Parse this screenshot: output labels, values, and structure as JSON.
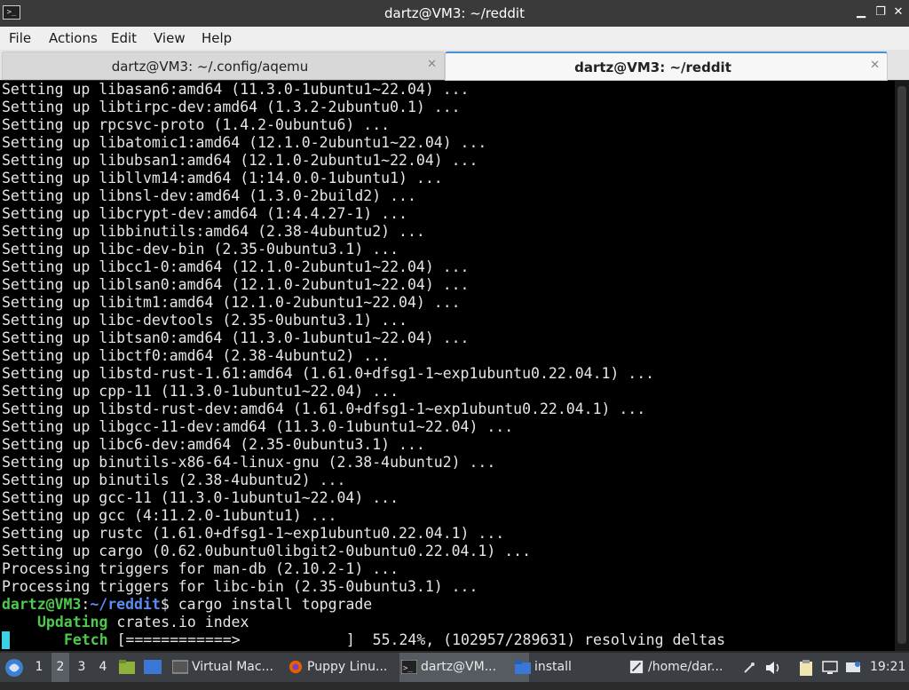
{
  "window": {
    "title": "dartz@VM3: ~/reddit"
  },
  "menu": [
    "File",
    "Actions",
    "Edit",
    "View",
    "Help"
  ],
  "tabs": [
    {
      "label": "dartz@VM3: ~/.config/aqemu",
      "active": false
    },
    {
      "label": "dartz@VM3: ~/reddit",
      "active": true
    }
  ],
  "terminal": {
    "output_lines": [
      "Setting up libasan6:amd64 (11.3.0-1ubuntu1~22.04) ...",
      "Setting up libtirpc-dev:amd64 (1.3.2-2ubuntu0.1) ...",
      "Setting up rpcsvc-proto (1.4.2-0ubuntu6) ...",
      "Setting up libatomic1:amd64 (12.1.0-2ubuntu1~22.04) ...",
      "Setting up libubsan1:amd64 (12.1.0-2ubuntu1~22.04) ...",
      "Setting up libllvm14:amd64 (1:14.0.0-1ubuntu1) ...",
      "Setting up libnsl-dev:amd64 (1.3.0-2build2) ...",
      "Setting up libcrypt-dev:amd64 (1:4.4.27-1) ...",
      "Setting up libbinutils:amd64 (2.38-4ubuntu2) ...",
      "Setting up libc-dev-bin (2.35-0ubuntu3.1) ...",
      "Setting up libcc1-0:amd64 (12.1.0-2ubuntu1~22.04) ...",
      "Setting up liblsan0:amd64 (12.1.0-2ubuntu1~22.04) ...",
      "Setting up libitm1:amd64 (12.1.0-2ubuntu1~22.04) ...",
      "Setting up libc-devtools (2.35-0ubuntu3.1) ...",
      "Setting up libtsan0:amd64 (11.3.0-1ubuntu1~22.04) ...",
      "Setting up libctf0:amd64 (2.38-4ubuntu2) ...",
      "Setting up libstd-rust-1.61:amd64 (1.61.0+dfsg1-1~exp1ubuntu0.22.04.1) ...",
      "Setting up cpp-11 (11.3.0-1ubuntu1~22.04) ...",
      "Setting up libstd-rust-dev:amd64 (1.61.0+dfsg1-1~exp1ubuntu0.22.04.1) ...",
      "Setting up libgcc-11-dev:amd64 (11.3.0-1ubuntu1~22.04) ...",
      "Setting up libc6-dev:amd64 (2.35-0ubuntu3.1) ...",
      "Setting up binutils-x86-64-linux-gnu (2.38-4ubuntu2) ...",
      "Setting up binutils (2.38-4ubuntu2) ...",
      "Setting up gcc-11 (11.3.0-1ubuntu1~22.04) ...",
      "Setting up gcc (4:11.2.0-1ubuntu1) ...",
      "Setting up rustc (1.61.0+dfsg1-1~exp1ubuntu0.22.04.1) ...",
      "Setting up cargo (0.62.0ubuntu0libgit2-0ubuntu0.22.04.1) ...",
      "Processing triggers for man-db (2.10.2-1) ...",
      "Processing triggers for libc-bin (2.35-0ubuntu3.1) ..."
    ],
    "prompt_user": "dartz@VM3",
    "prompt_sep": ":",
    "prompt_path": "~/reddit",
    "prompt_symbol": "$",
    "command": " cargo install topgrade",
    "updating_label": "Updating",
    "updating_text": " crates.io index",
    "fetch_label": "Fetch",
    "fetch_text": " [============>            ]  55.24%, (102957/289631) resolving deltas",
    "colors": {
      "prompt": "#4ec94e",
      "path": "#5b8cf0",
      "cursor": "#39d1e6",
      "background": "#000000"
    }
  },
  "taskbar": {
    "workspaces": [
      "1",
      "2",
      "3",
      "4"
    ],
    "active_workspace": "2",
    "tasks": [
      {
        "label": "Virtual Mac...",
        "icon": "virtual-machine-icon"
      },
      {
        "label": "Puppy Linu...",
        "icon": "firefox-icon"
      },
      {
        "label": "dartz@VM...",
        "icon": "terminal-icon"
      },
      {
        "label": "install",
        "icon": "folder-icon"
      },
      {
        "label": "/home/dar...",
        "icon": "text-editor-icon"
      }
    ],
    "clock": "19:21"
  }
}
